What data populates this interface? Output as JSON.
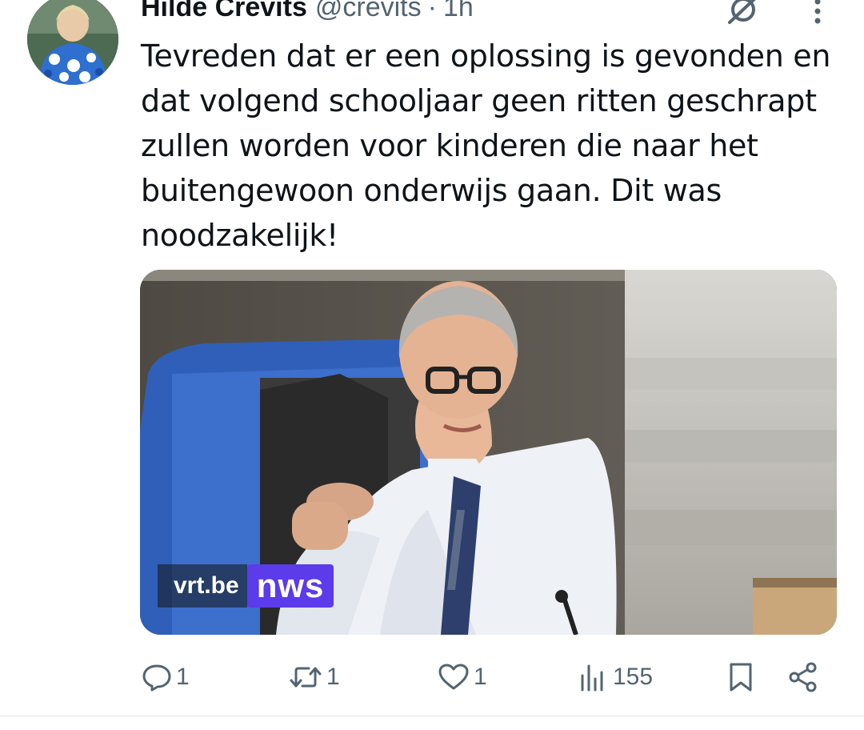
{
  "author": {
    "name": "Hilde Crevits",
    "handle": "@crevits",
    "separator": "·",
    "time": "1h"
  },
  "tweet": {
    "text": "Tevreden dat er een oplossing is gevonden en dat volgend schooljaar geen ritten geschrapt zullen worden voor kinderen die naar het buitengewoon onderwijs gaan. Dit was noodzakelijk!"
  },
  "media": {
    "watermark_vrt": "vrt.be",
    "watermark_nws": "nws"
  },
  "actions": {
    "replies": "1",
    "reposts": "1",
    "likes": "1",
    "views": "155"
  },
  "icons": {
    "reply": "speech-bubble-icon",
    "repost": "repost-arrows-icon",
    "like": "heart-icon",
    "views": "bar-chart-icon",
    "bookmark": "bookmark-icon",
    "share": "share-icon",
    "grok": "grok-icon",
    "more": "more-dots-icon"
  },
  "colors": {
    "text": "#0f1419",
    "secondary": "#536471",
    "nws_brand": "#5b3bea"
  }
}
